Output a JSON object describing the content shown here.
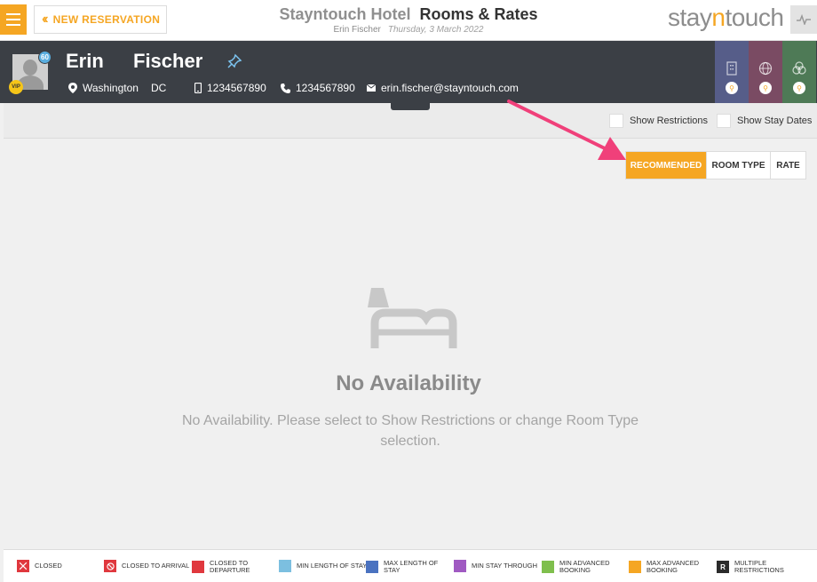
{
  "header": {
    "new_reservation_label": "NEW RESERVATION",
    "hotel_name": "Stayntouch Hotel",
    "page_title": "Rooms & Rates",
    "user_name": "Erin Fischer",
    "business_date": "Thursday, 3 March 2022",
    "logo": {
      "part1": "stay",
      "part2": "n",
      "part3": "touch"
    },
    "accent_color": "#f5a623"
  },
  "guest": {
    "first_name": "Erin",
    "last_name": "Fischer",
    "loyalty_points": "60",
    "vip_label": "VIP",
    "city": "Washington",
    "state": "DC",
    "mobile": "1234567890",
    "phone": "1234567890",
    "email": "erin.fischer@stayntouch.com",
    "tiles": [
      {
        "icon": "building-icon",
        "color": "#565d89"
      },
      {
        "icon": "globe-icon",
        "color": "#7a4b63"
      },
      {
        "icon": "circles-icon",
        "color": "#4e7a56"
      }
    ]
  },
  "filters": {
    "show_restrictions": "Show Restrictions",
    "show_stay_dates": "Show Stay Dates"
  },
  "view_toggle": {
    "options": [
      "RECOMMENDED",
      "ROOM TYPE",
      "RATE"
    ],
    "active": "RECOMMENDED"
  },
  "empty_state": {
    "title": "No Availability",
    "message": "No Availability. Please select to Show Restrictions or change Room Type selection."
  },
  "legend": [
    {
      "label": "CLOSED",
      "color": "#e0383e",
      "icon": "x-icon"
    },
    {
      "label": "CLOSED TO ARRIVAL",
      "color": "#e0383e",
      "icon": "no-entry-icon"
    },
    {
      "label": "CLOSED TO DEPARTURE",
      "color": "#e0383e",
      "icon": ""
    },
    {
      "label": "MIN LENGTH OF STAY",
      "color": "#7cbfe0",
      "icon": ""
    },
    {
      "label": "MAX LENGTH OF STAY",
      "color": "#4a72c0",
      "icon": ""
    },
    {
      "label": "MIN STAY THROUGH",
      "color": "#a05ac2",
      "icon": ""
    },
    {
      "label": "MIN ADVANCED BOOKING",
      "color": "#7fbf4d",
      "icon": ""
    },
    {
      "label": "MAX ADVANCED BOOKING",
      "color": "#f5a623",
      "icon": ""
    },
    {
      "label": "MULTIPLE RESTRICTIONS",
      "color": "#2b2b2b",
      "icon": "r-letter-icon",
      "glyph": "R"
    }
  ]
}
